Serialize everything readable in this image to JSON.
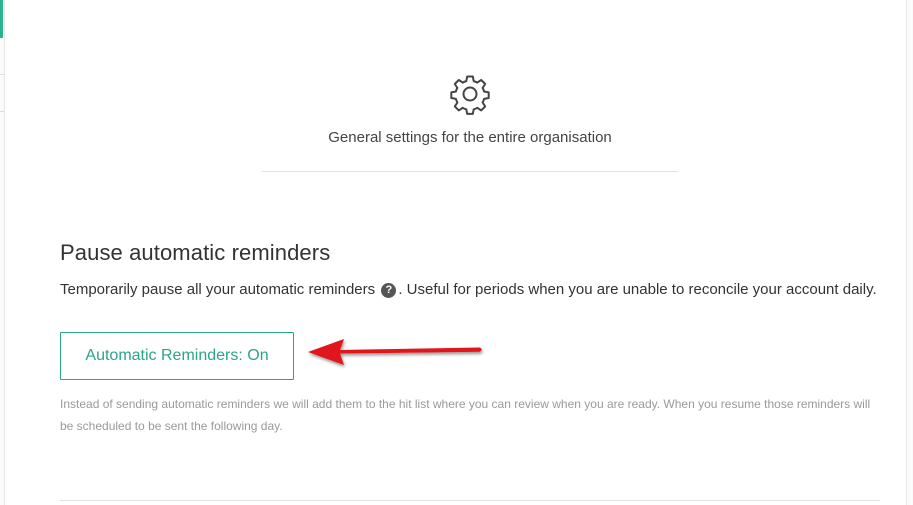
{
  "header": {
    "icon": "gear-icon",
    "description": "General settings for the entire organisation"
  },
  "pause_section": {
    "title": "Pause automatic reminders",
    "description_before": "Temporarily pause all your automatic reminders",
    "help_icon": "question-mark-icon",
    "help_glyph": "?",
    "description_after": ". Useful for periods when you are unable to reconcile your account daily.",
    "toggle_label": "Automatic Reminders: On",
    "helper_text": "Instead of sending automatic reminders we will add them to the hit list where you can review when you are ready. When you resume those reminders will be scheduled to be sent the following day."
  },
  "annotation": {
    "arrow_color": "#e0141b"
  },
  "colors": {
    "accent": "#2aa58a",
    "sidebar_accent": "#2ab38e",
    "muted_text": "#9a9a9a"
  }
}
